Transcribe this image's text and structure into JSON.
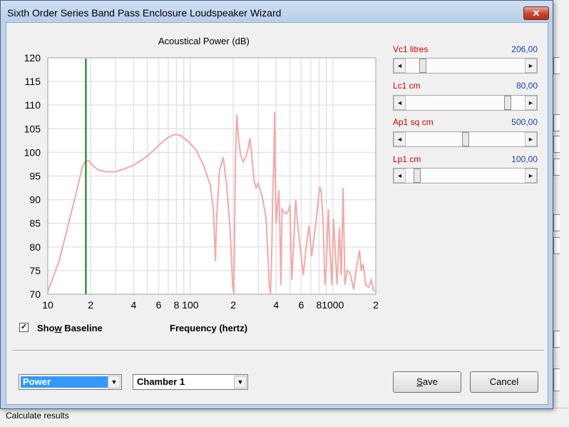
{
  "window": {
    "title": "Sixth Order Series Band Pass Enclosure Loudspeaker Wizard",
    "close_glyph": "✕"
  },
  "status_bar": {
    "text": "Calculate results"
  },
  "params": [
    {
      "label": "Vc1  litres",
      "value": "206,00",
      "thumb_position": 0.12
    },
    {
      "label": "Lc1  cm",
      "value": "80,00",
      "thumb_position": 0.88
    },
    {
      "label": "Ap1  sq cm",
      "value": "500,00",
      "thumb_position": 0.5
    },
    {
      "label": "Lp1  cm",
      "value": "100,00",
      "thumb_position": 0.07
    }
  ],
  "controls": {
    "show_baseline": {
      "label_pre": "Sho",
      "label_key": "w",
      "label_post": " Baseline",
      "checked": true,
      "check_glyph": "✓"
    },
    "mode_select": {
      "value": "Power"
    },
    "chamber_select": {
      "value": "Chamber 1"
    },
    "save_label_key": "S",
    "save_label_rest": "ave",
    "cancel_label": "Cancel",
    "arrow_left": "◄",
    "arrow_right": "►",
    "arrow_down": "▼"
  },
  "chart_data": {
    "type": "line",
    "title": "Acoustical Power (dB)",
    "xlabel": "Frequency (hertz)",
    "ylabel": "",
    "x_scale": "log",
    "xlim": [
      10,
      2000
    ],
    "ylim": [
      70,
      120
    ],
    "y_ticks": [
      70,
      75,
      80,
      85,
      90,
      95,
      100,
      105,
      110,
      115,
      120
    ],
    "x_tick_labels": [
      {
        "x": 10,
        "label": "10"
      },
      {
        "x": 20,
        "label": "2"
      },
      {
        "x": 40,
        "label": "4"
      },
      {
        "x": 60,
        "label": "6"
      },
      {
        "x": 80,
        "label": "8"
      },
      {
        "x": 100,
        "label": "100"
      },
      {
        "x": 200,
        "label": "2"
      },
      {
        "x": 400,
        "label": "4"
      },
      {
        "x": 600,
        "label": "6"
      },
      {
        "x": 800,
        "label": "8"
      },
      {
        "x": 1000,
        "label": "1000"
      },
      {
        "x": 2000,
        "label": "2"
      }
    ],
    "grid": true,
    "colors": {
      "response": "#f4a8a8",
      "marker": "#008000",
      "grid": "#e3e3e3",
      "plot_bg": "#ffffff"
    },
    "marker_line_x": 18.5,
    "series": [
      {
        "values": [
          [
            10.0,
            70.5
          ],
          [
            12.0,
            77.0
          ],
          [
            14.0,
            85.0
          ],
          [
            16.0,
            92.0
          ],
          [
            17.5,
            97.0
          ],
          [
            18.5,
            98.3
          ],
          [
            19.5,
            98.2
          ],
          [
            21.0,
            97.0
          ],
          [
            23.0,
            96.2
          ],
          [
            26.0,
            95.9
          ],
          [
            30.0,
            95.9
          ],
          [
            35.0,
            96.6
          ],
          [
            40.0,
            97.3
          ],
          [
            50.0,
            99.2
          ],
          [
            60.0,
            101.5
          ],
          [
            70.0,
            103.2
          ],
          [
            78.0,
            103.8
          ],
          [
            85.0,
            103.6
          ],
          [
            95.0,
            102.5
          ],
          [
            110.0,
            100.5
          ],
          [
            125.0,
            97.0
          ],
          [
            138.0,
            93.0
          ],
          [
            145.0,
            88.0
          ],
          [
            150.0,
            77.0
          ],
          [
            153.0,
            86.0
          ],
          [
            160.0,
            96.0
          ],
          [
            170.0,
            99.0
          ],
          [
            180.0,
            93.0
          ],
          [
            190.0,
            84.0
          ],
          [
            198.0,
            72.0
          ],
          [
            202.0,
            70.0
          ],
          [
            207.0,
            98.0
          ],
          [
            212.0,
            108.0
          ],
          [
            217.0,
            103.5
          ],
          [
            225.0,
            99.5
          ],
          [
            235.0,
            98.0
          ],
          [
            245.0,
            99.0
          ],
          [
            255.0,
            101.0
          ],
          [
            262.0,
            103.0
          ],
          [
            270.0,
            99.5
          ],
          [
            280.0,
            94.0
          ],
          [
            290.0,
            92.5
          ],
          [
            300.0,
            93.5
          ],
          [
            320.0,
            90.5
          ],
          [
            340.0,
            86.0
          ],
          [
            358.0,
            72.0
          ],
          [
            365.0,
            70.0
          ],
          [
            372.0,
            78.0
          ],
          [
            378.0,
            90.0
          ],
          [
            386.0,
            100.0
          ],
          [
            390.0,
            108.5
          ],
          [
            394.0,
            95.0
          ],
          [
            400.0,
            85.0
          ],
          [
            410.0,
            89.0
          ],
          [
            418.0,
            92.0
          ],
          [
            425.0,
            84.0
          ],
          [
            432.0,
            72.0
          ],
          [
            440.0,
            88.0
          ],
          [
            450.0,
            87.5
          ],
          [
            470.0,
            87.0
          ],
          [
            490.0,
            87.8
          ],
          [
            500.0,
            89.0
          ],
          [
            515.0,
            73.0
          ],
          [
            530.0,
            80.0
          ],
          [
            548.0,
            90.0
          ],
          [
            570.0,
            84.0
          ],
          [
            590.0,
            80.0
          ],
          [
            620.0,
            74.0
          ],
          [
            650.0,
            80.0
          ],
          [
            680.0,
            84.5
          ],
          [
            710.0,
            78.0
          ],
          [
            760.0,
            85.0
          ],
          [
            790.0,
            90.0
          ],
          [
            810.0,
            92.7
          ],
          [
            830.0,
            91.5
          ],
          [
            855.0,
            85.0
          ],
          [
            880.0,
            72.0
          ],
          [
            900.0,
            76.0
          ],
          [
            930.0,
            88.0
          ],
          [
            955.0,
            79.0
          ],
          [
            985.0,
            72.0
          ],
          [
            1010.0,
            86.0
          ],
          [
            1040.0,
            79.0
          ],
          [
            1070.0,
            72.0
          ],
          [
            1110.0,
            84.0
          ],
          [
            1145.0,
            74.0
          ],
          [
            1180.0,
            92.5
          ],
          [
            1215.0,
            72.0
          ],
          [
            1260.0,
            75.0
          ],
          [
            1320.0,
            74.5
          ],
          [
            1400.0,
            71.0
          ],
          [
            1470.0,
            76.0
          ],
          [
            1540.0,
            79.3
          ],
          [
            1580.0,
            75.0
          ],
          [
            1630.0,
            76.5
          ],
          [
            1700.0,
            72.0
          ],
          [
            1780.0,
            71.5
          ],
          [
            1860.0,
            73.0
          ],
          [
            1920.0,
            71.0
          ],
          [
            1960.0,
            70.5
          ]
        ]
      }
    ]
  }
}
